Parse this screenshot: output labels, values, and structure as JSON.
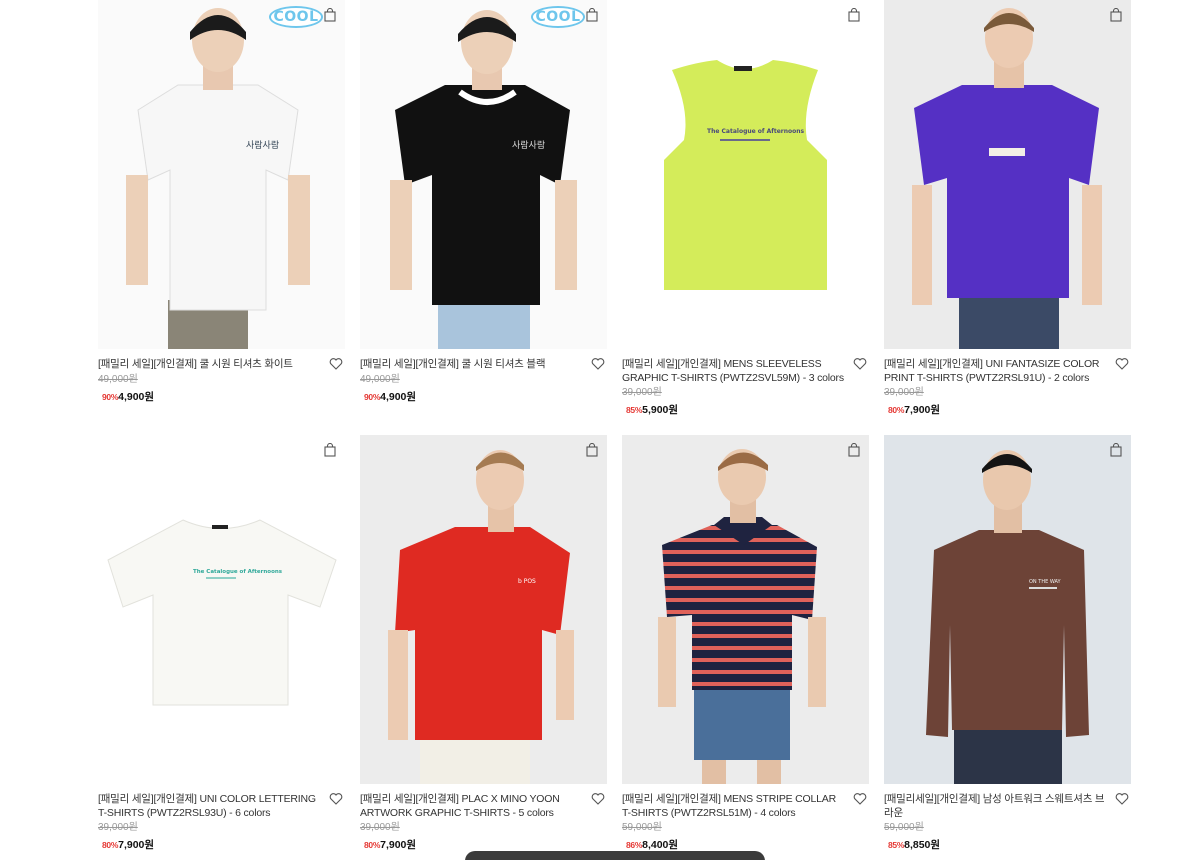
{
  "products": [
    {
      "name": "[패밀리 세일][개인결제] 쿨 시원 티셔츠 화이트",
      "original_price": "49,000원",
      "discount": "90%",
      "price": "4,900원",
      "badge": "COOL",
      "image": "white-tshirt-model"
    },
    {
      "name": "[패밀리 세일][개인결제] 쿨 시원 티셔츠 블랙",
      "original_price": "49,000원",
      "discount": "90%",
      "price": "4,900원",
      "badge": "COOL",
      "image": "black-tshirt-model"
    },
    {
      "name": "[패밀리 세일][개인결제] MENS SLEEVELESS GRAPHIC T-SHIRTS (PWTZ2SVL59M) - 3 colors",
      "original_price": "39,000원",
      "discount": "85%",
      "price": "5,900원",
      "image": "lime-sleeveless-flat"
    },
    {
      "name": "[패밀리 세일][개인결제] UNI FANTASIZE COLOR PRINT T-SHIRTS (PWTZ2RSL91U) - 2 colors",
      "original_price": "39,000원",
      "discount": "80%",
      "price": "7,900원",
      "image": "purple-tshirt-model"
    },
    {
      "name": "[패밀리 세일][개인결제] UNI COLOR LETTERING T-SHIRTS (PWTZ2RSL93U) - 6 colors",
      "original_price": "39,000원",
      "discount": "80%",
      "price": "7,900원",
      "image": "white-tshirt-flat"
    },
    {
      "name": "[패밀리 세일][개인결제] PLAC X MINO YOON ARTWORK GRAPHIC T-SHIRTS - 5 colors",
      "original_price": "39,000원",
      "discount": "80%",
      "price": "7,900원",
      "image": "red-tshirt-model"
    },
    {
      "name": "[패밀리 세일][개인결제] MENS STRIPE COLLAR T-SHIRTS (PWTZ2RSL51M) - 4 colors",
      "original_price": "59,000원",
      "discount": "86%",
      "price": "8,400원",
      "image": "stripe-polo-model"
    },
    {
      "name": "[패밀리세일][개인결제] 남성 아트워크 스웨트셔츠 브라운",
      "original_price": "59,000원",
      "discount": "85%",
      "price": "8,850원",
      "image": "brown-sweatshirt-model"
    }
  ],
  "icons": {
    "cart": "shopping-bag-icon",
    "wishlist": "heart-icon"
  },
  "colors": {
    "discount": "#e53935",
    "badge": "#6ec6ec"
  }
}
